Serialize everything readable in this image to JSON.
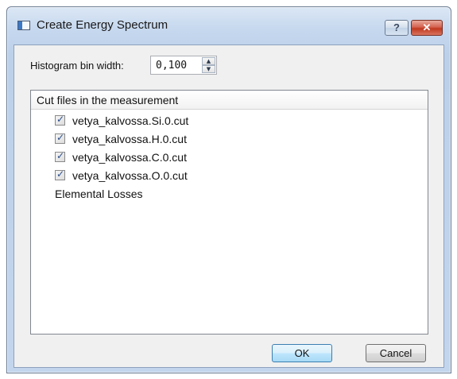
{
  "window": {
    "title": "Create Energy Spectrum",
    "help_label": "?",
    "close_label": "✕"
  },
  "bin": {
    "label": "Histogram bin width:",
    "value": "0,100",
    "up_glyph": "▲",
    "down_glyph": "▼"
  },
  "tree": {
    "header": "Cut files in the measurement",
    "check_glyph": "✓",
    "items": [
      {
        "label": "vetya_kalvossa.Si.0.cut",
        "checked": true
      },
      {
        "label": "vetya_kalvossa.H.0.cut",
        "checked": true
      },
      {
        "label": "vetya_kalvossa.C.0.cut",
        "checked": true
      },
      {
        "label": "vetya_kalvossa.O.0.cut",
        "checked": true
      }
    ],
    "group": "Elemental Losses"
  },
  "buttons": {
    "ok": "OK",
    "cancel": "Cancel"
  },
  "colors": {
    "titlebar": "#c6d8ee",
    "close_button": "#c0391f",
    "ok_button": "#bee6fd",
    "dialog_bg": "#f0f0f0"
  },
  "icons": {
    "app": "app-window-icon",
    "help": "help-icon",
    "close": "close-icon",
    "spin_up": "chevron-up-icon",
    "spin_down": "chevron-down-icon",
    "checkbox": "checkmark-icon"
  }
}
